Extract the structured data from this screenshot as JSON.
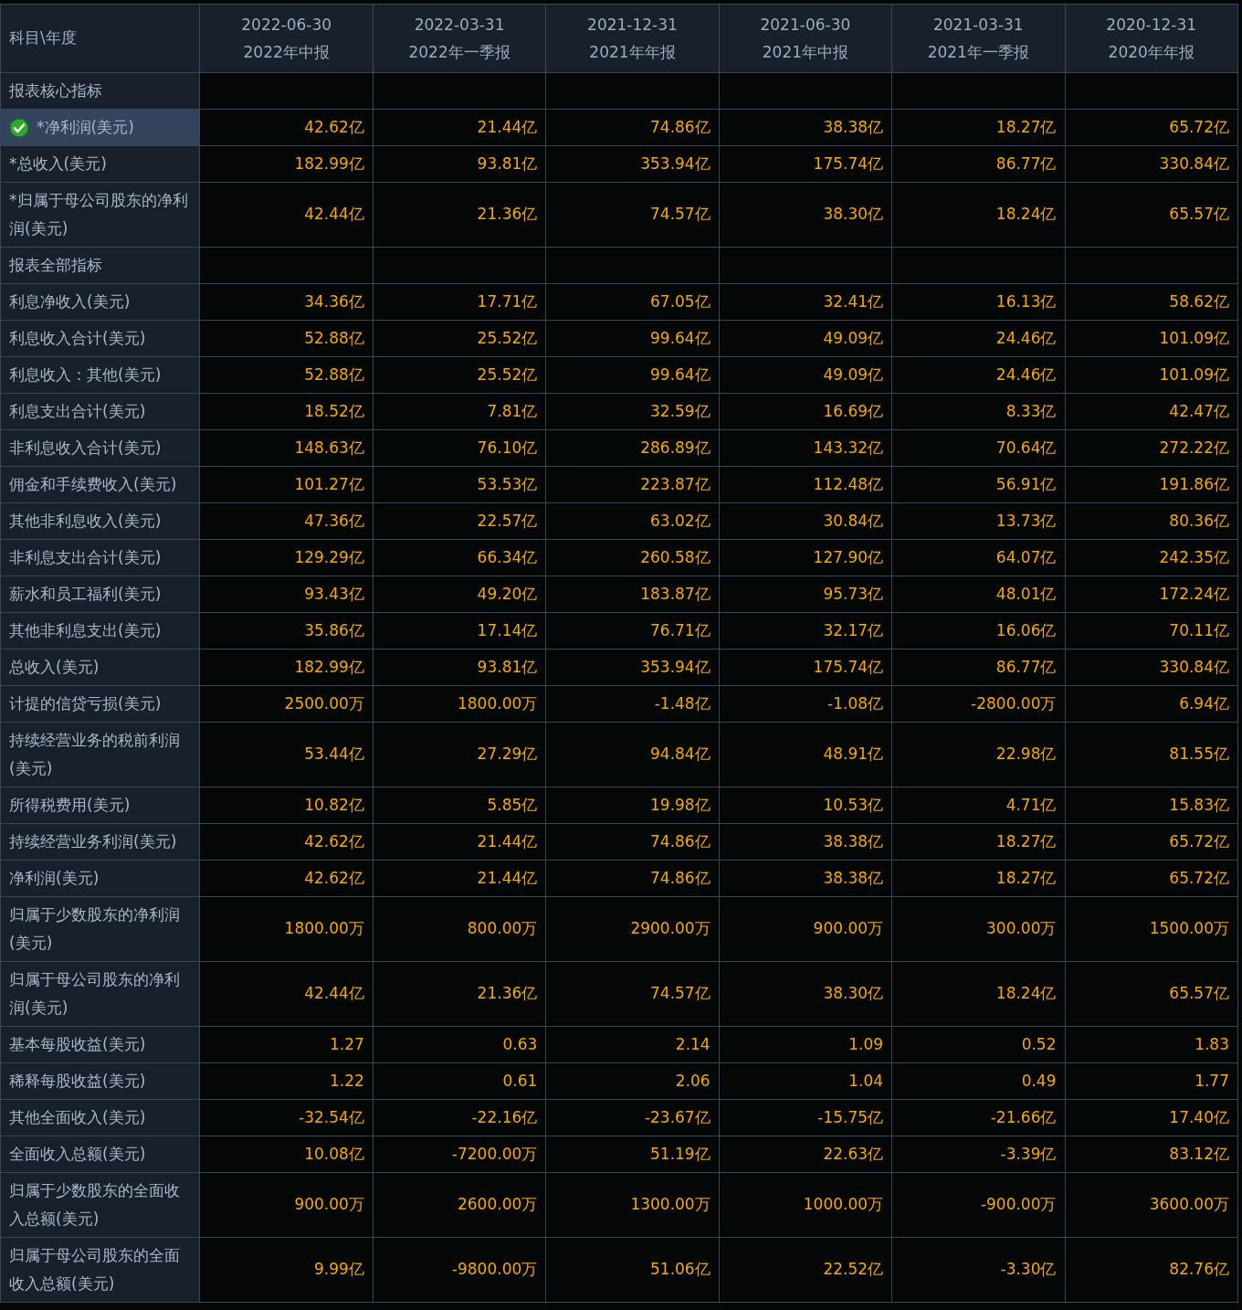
{
  "corner_label": "科目\\年度",
  "columns": [
    {
      "date": "2022-06-30",
      "report": "2022年中报"
    },
    {
      "date": "2022-03-31",
      "report": "2022年一季报"
    },
    {
      "date": "2021-12-31",
      "report": "2021年年报"
    },
    {
      "date": "2021-06-30",
      "report": "2021年中报"
    },
    {
      "date": "2021-03-31",
      "report": "2021年一季报"
    },
    {
      "date": "2020-12-31",
      "report": "2020年年报"
    }
  ],
  "rows": [
    {
      "kind": "section",
      "label": "报表核心指标",
      "selected": false
    },
    {
      "kind": "data",
      "label": "*净利润(美元)",
      "selected": true,
      "values": [
        "42.62亿",
        "21.44亿",
        "74.86亿",
        "38.38亿",
        "18.27亿",
        "65.72亿"
      ]
    },
    {
      "kind": "data",
      "label": "*总收入(美元)",
      "selected": false,
      "values": [
        "182.99亿",
        "93.81亿",
        "353.94亿",
        "175.74亿",
        "86.77亿",
        "330.84亿"
      ]
    },
    {
      "kind": "data",
      "label": "*归属于母公司股东的净利润(美元)",
      "selected": false,
      "values": [
        "42.44亿",
        "21.36亿",
        "74.57亿",
        "38.30亿",
        "18.24亿",
        "65.57亿"
      ]
    },
    {
      "kind": "section",
      "label": "报表全部指标",
      "selected": false
    },
    {
      "kind": "data",
      "label": "利息净收入(美元)",
      "selected": false,
      "values": [
        "34.36亿",
        "17.71亿",
        "67.05亿",
        "32.41亿",
        "16.13亿",
        "58.62亿"
      ]
    },
    {
      "kind": "data",
      "label": "利息收入合计(美元)",
      "selected": false,
      "values": [
        "52.88亿",
        "25.52亿",
        "99.64亿",
        "49.09亿",
        "24.46亿",
        "101.09亿"
      ]
    },
    {
      "kind": "data",
      "label": "利息收入：其他(美元)",
      "selected": false,
      "values": [
        "52.88亿",
        "25.52亿",
        "99.64亿",
        "49.09亿",
        "24.46亿",
        "101.09亿"
      ]
    },
    {
      "kind": "data",
      "label": "利息支出合计(美元)",
      "selected": false,
      "values": [
        "18.52亿",
        "7.81亿",
        "32.59亿",
        "16.69亿",
        "8.33亿",
        "42.47亿"
      ]
    },
    {
      "kind": "data",
      "label": "非利息收入合计(美元)",
      "selected": false,
      "values": [
        "148.63亿",
        "76.10亿",
        "286.89亿",
        "143.32亿",
        "70.64亿",
        "272.22亿"
      ]
    },
    {
      "kind": "data",
      "label": "佣金和手续费收入(美元)",
      "selected": false,
      "values": [
        "101.27亿",
        "53.53亿",
        "223.87亿",
        "112.48亿",
        "56.91亿",
        "191.86亿"
      ]
    },
    {
      "kind": "data",
      "label": "其他非利息收入(美元)",
      "selected": false,
      "values": [
        "47.36亿",
        "22.57亿",
        "63.02亿",
        "30.84亿",
        "13.73亿",
        "80.36亿"
      ]
    },
    {
      "kind": "data",
      "label": "非利息支出合计(美元)",
      "selected": false,
      "values": [
        "129.29亿",
        "66.34亿",
        "260.58亿",
        "127.90亿",
        "64.07亿",
        "242.35亿"
      ]
    },
    {
      "kind": "data",
      "label": "薪水和员工福利(美元)",
      "selected": false,
      "values": [
        "93.43亿",
        "49.20亿",
        "183.87亿",
        "95.73亿",
        "48.01亿",
        "172.24亿"
      ]
    },
    {
      "kind": "data",
      "label": "其他非利息支出(美元)",
      "selected": false,
      "values": [
        "35.86亿",
        "17.14亿",
        "76.71亿",
        "32.17亿",
        "16.06亿",
        "70.11亿"
      ]
    },
    {
      "kind": "data",
      "label": "总收入(美元)",
      "selected": false,
      "values": [
        "182.99亿",
        "93.81亿",
        "353.94亿",
        "175.74亿",
        "86.77亿",
        "330.84亿"
      ]
    },
    {
      "kind": "data",
      "label": "计提的信贷亏损(美元)",
      "selected": false,
      "values": [
        "2500.00万",
        "1800.00万",
        "-1.48亿",
        "-1.08亿",
        "-2800.00万",
        "6.94亿"
      ]
    },
    {
      "kind": "data",
      "label": "持续经营业务的税前利润(美元)",
      "selected": false,
      "values": [
        "53.44亿",
        "27.29亿",
        "94.84亿",
        "48.91亿",
        "22.98亿",
        "81.55亿"
      ]
    },
    {
      "kind": "data",
      "label": "所得税费用(美元)",
      "selected": false,
      "values": [
        "10.82亿",
        "5.85亿",
        "19.98亿",
        "10.53亿",
        "4.71亿",
        "15.83亿"
      ]
    },
    {
      "kind": "data",
      "label": "持续经营业务利润(美元)",
      "selected": false,
      "values": [
        "42.62亿",
        "21.44亿",
        "74.86亿",
        "38.38亿",
        "18.27亿",
        "65.72亿"
      ]
    },
    {
      "kind": "data",
      "label": "净利润(美元)",
      "selected": false,
      "values": [
        "42.62亿",
        "21.44亿",
        "74.86亿",
        "38.38亿",
        "18.27亿",
        "65.72亿"
      ]
    },
    {
      "kind": "data",
      "label": "归属于少数股东的净利润(美元)",
      "selected": false,
      "values": [
        "1800.00万",
        "800.00万",
        "2900.00万",
        "900.00万",
        "300.00万",
        "1500.00万"
      ]
    },
    {
      "kind": "data",
      "label": "归属于母公司股东的净利润(美元)",
      "selected": false,
      "values": [
        "42.44亿",
        "21.36亿",
        "74.57亿",
        "38.30亿",
        "18.24亿",
        "65.57亿"
      ]
    },
    {
      "kind": "data",
      "label": "基本每股收益(美元)",
      "selected": false,
      "values": [
        "1.27",
        "0.63",
        "2.14",
        "1.09",
        "0.52",
        "1.83"
      ]
    },
    {
      "kind": "data",
      "label": "稀释每股收益(美元)",
      "selected": false,
      "values": [
        "1.22",
        "0.61",
        "2.06",
        "1.04",
        "0.49",
        "1.77"
      ]
    },
    {
      "kind": "data",
      "label": "其他全面收入(美元)",
      "selected": false,
      "values": [
        "-32.54亿",
        "-22.16亿",
        "-23.67亿",
        "-15.75亿",
        "-21.66亿",
        "17.40亿"
      ]
    },
    {
      "kind": "data",
      "label": "全面收入总额(美元)",
      "selected": false,
      "values": [
        "10.08亿",
        "-7200.00万",
        "51.19亿",
        "22.63亿",
        "-3.39亿",
        "83.12亿"
      ]
    },
    {
      "kind": "data",
      "label": "归属于少数股东的全面收入总额(美元)",
      "selected": false,
      "values": [
        "900.00万",
        "2600.00万",
        "1300.00万",
        "1000.00万",
        "-900.00万",
        "3600.00万"
      ]
    },
    {
      "kind": "data",
      "label": "归属于母公司股东的全面收入总额(美元)",
      "selected": false,
      "values": [
        "9.99亿",
        "-9800.00万",
        "51.06亿",
        "22.52亿",
        "-3.30亿",
        "82.76亿"
      ]
    }
  ]
}
